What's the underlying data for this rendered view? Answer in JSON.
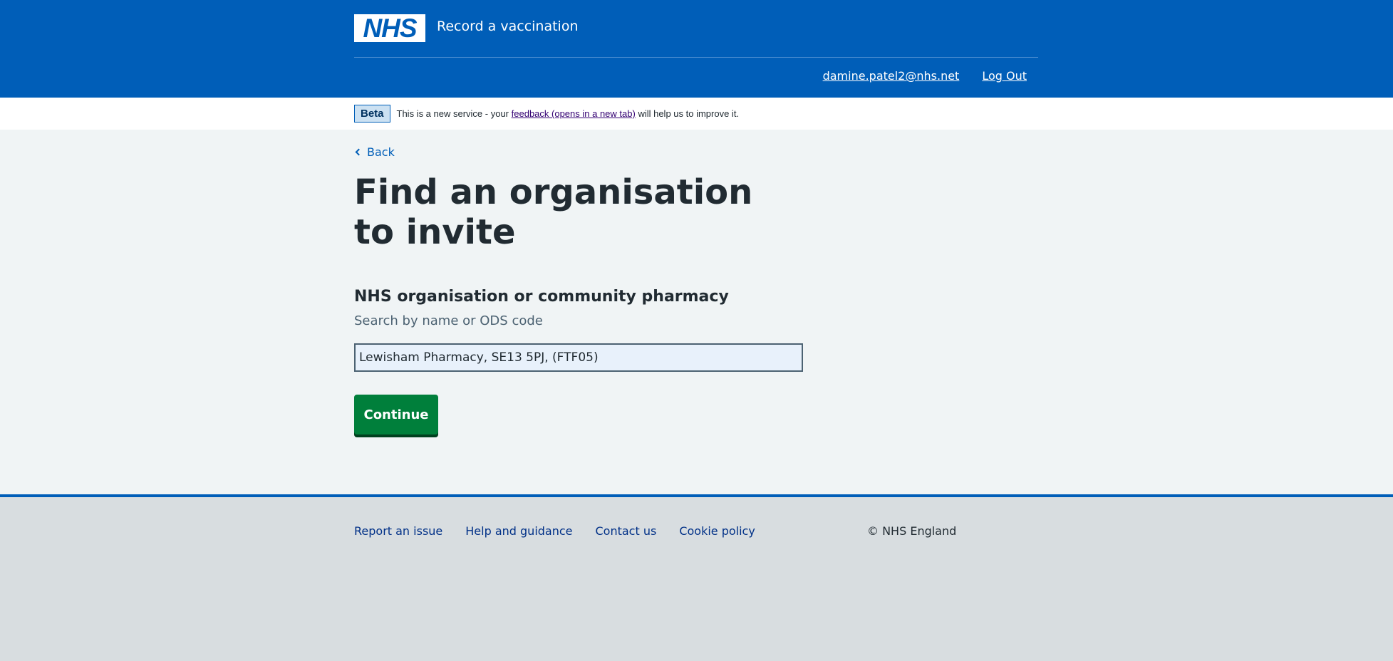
{
  "header": {
    "logo_text": "NHS",
    "service_name": "Record a vaccination",
    "nav": {
      "user_email": "damine.patel2@nhs.net",
      "logout_label": "Log Out"
    }
  },
  "phase_banner": {
    "tag": "Beta",
    "text_before": "This is a new service - your",
    "link_text": "feedback (opens in a new tab)",
    "text_after": "will help us to improve it."
  },
  "main": {
    "back_label": "Back",
    "title": "Find an organisation to invite",
    "field_label": "NHS organisation or community pharmacy",
    "field_hint": "Search by name or ODS code",
    "field_value": "Lewisham Pharmacy, SE13 5PJ, (FTF05)",
    "continue_label": "Continue"
  },
  "footer": {
    "links": [
      {
        "label": "Report an issue"
      },
      {
        "label": "Help and guidance"
      },
      {
        "label": "Contact us"
      },
      {
        "label": "Cookie policy"
      }
    ],
    "copyright": "© NHS England"
  },
  "colors": {
    "brand_blue": "#005eb8",
    "button_green": "#007f3b",
    "page_bg": "#f0f4f5",
    "footer_bg": "#d8dde0"
  }
}
